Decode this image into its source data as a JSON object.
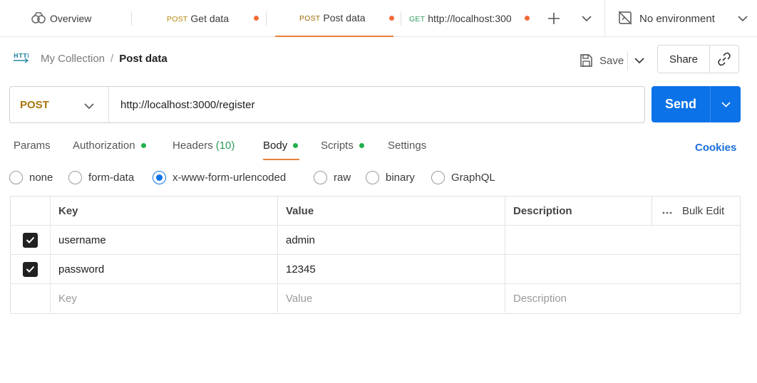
{
  "tabs": {
    "overview_label": "Overview",
    "items": [
      {
        "method": "POST",
        "label": "Get data"
      },
      {
        "method": "POST",
        "label": "Post data"
      },
      {
        "method": "GET",
        "label": "http://localhost:300"
      }
    ],
    "environment_label": "No environment"
  },
  "header": {
    "icon_text": "HTTP",
    "collection": "My Collection",
    "separator": "/",
    "request_name": "Post data",
    "save_label": "Save",
    "share_label": "Share"
  },
  "request": {
    "method": "POST",
    "url": "http://localhost:3000/register",
    "send_label": "Send"
  },
  "subtabs": {
    "params": "Params",
    "authorization": "Authorization",
    "headers": "Headers",
    "headers_count": "(10)",
    "body": "Body",
    "scripts": "Scripts",
    "settings": "Settings",
    "cookies": "Cookies"
  },
  "body_types": {
    "none": "none",
    "form_data": "form-data",
    "urlencoded": "x-www-form-urlencoded",
    "raw": "raw",
    "binary": "binary",
    "graphql": "GraphQL",
    "selected": "x-www-form-urlencoded"
  },
  "table": {
    "headers": {
      "key": "Key",
      "value": "Value",
      "description": "Description",
      "bulk_edit": "Bulk Edit"
    },
    "rows": [
      {
        "key": "username",
        "value": "admin",
        "description": ""
      },
      {
        "key": "password",
        "value": "12345",
        "description": ""
      }
    ],
    "placeholders": {
      "key": "Key",
      "value": "Value",
      "description": "Description"
    }
  },
  "colors": {
    "accent": "#e9803c",
    "send": "#0b72e7",
    "post_method": "#a9740b",
    "get_method": "#2f9e62",
    "unsaved_dot": "#f26b3a",
    "status_dot": "#22b04b"
  }
}
